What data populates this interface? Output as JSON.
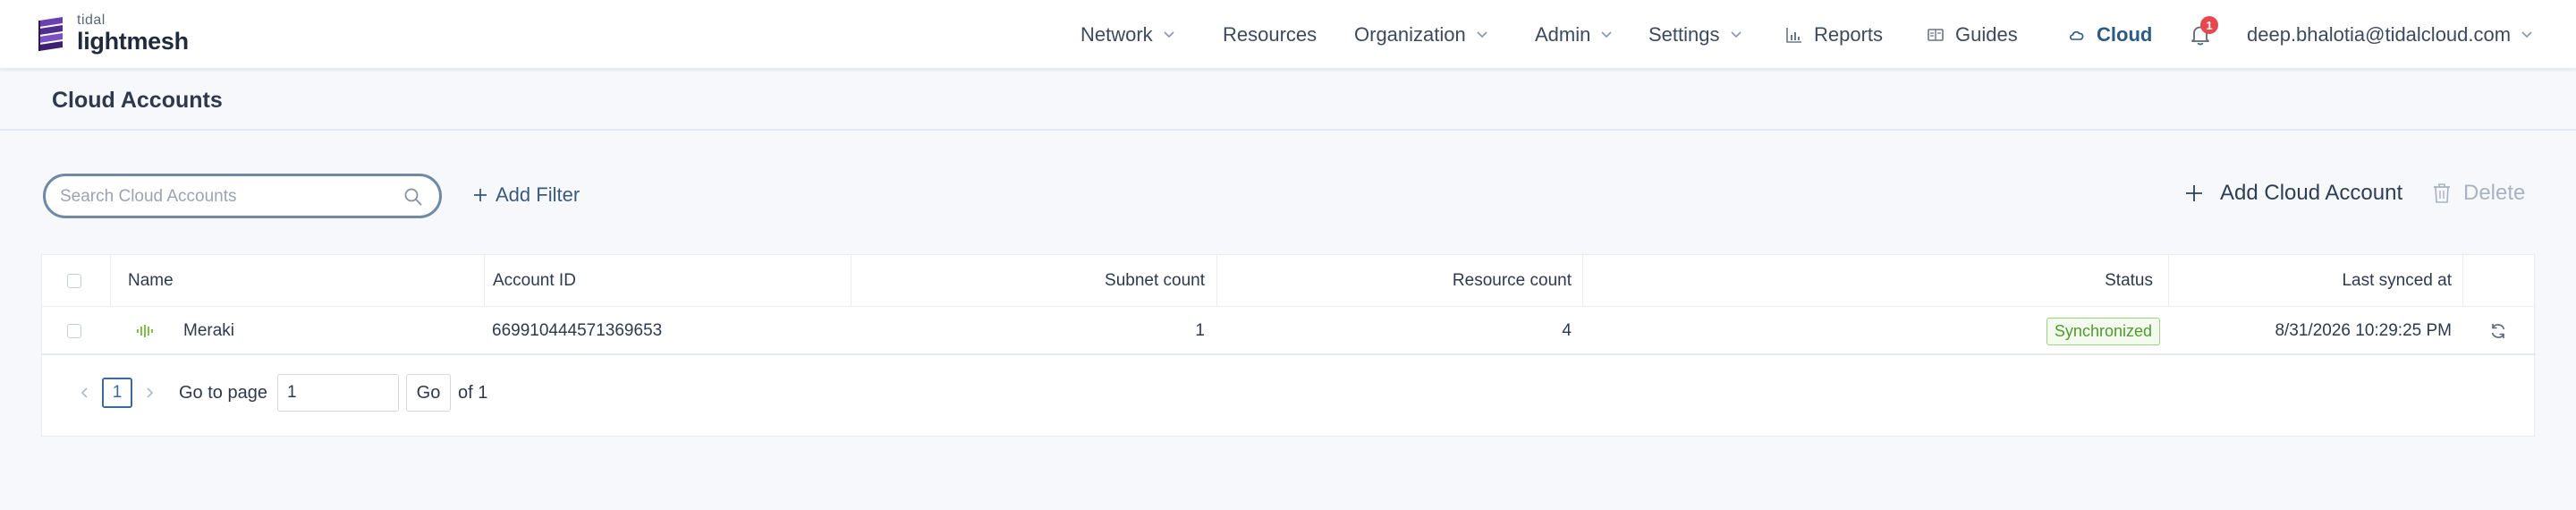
{
  "brand": {
    "small": "tidal",
    "big": "lightmesh"
  },
  "nav": {
    "network": "Network",
    "resources": "Resources",
    "organization": "Organization",
    "admin": "Admin",
    "settings": "Settings",
    "reports": "Reports",
    "guides": "Guides",
    "cloud": "Cloud",
    "notification_count": "1",
    "user": "deep.bhalotia@tidalcloud.com"
  },
  "page": {
    "title": "Cloud Accounts"
  },
  "toolbar": {
    "search_placeholder": "Search Cloud Accounts",
    "add_filter": "Add Filter",
    "add_account": "Add Cloud Account",
    "delete": "Delete"
  },
  "table": {
    "columns": {
      "name": "Name",
      "account_id": "Account ID",
      "subnet_count": "Subnet count",
      "resource_count": "Resource count",
      "status": "Status",
      "last_synced": "Last synced at"
    },
    "rows": [
      {
        "provider_icon": "meraki-icon",
        "name": "Meraki",
        "account_id": "669910444571369653",
        "subnet_count": "1",
        "resource_count": "4",
        "status": "Synchronized",
        "last_synced": "8/31/2026 10:29:25 PM"
      }
    ]
  },
  "pagination": {
    "current_page": "1",
    "go_to_label": "Go to page",
    "input_value": "1",
    "go_label": "Go",
    "of_label": "of 1"
  },
  "colors": {
    "accent": "#2c5a86",
    "status_green": "#4f9a2e",
    "badge_red": "#e5484d"
  }
}
